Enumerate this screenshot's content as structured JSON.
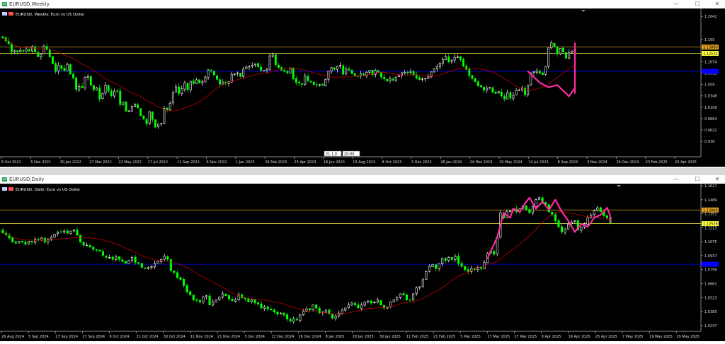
{
  "windows": [
    {
      "title": "EURUSD,Weekly",
      "subtitle": "EURUSD, Weekly: Euro vs US Dollar",
      "chart_data": {
        "type": "candlestick",
        "symbol": "EURUSD",
        "timeframe": "Weekly",
        "ylim": [
          0.905,
          1.215
        ],
        "yticks": [
          1.2042,
          1.155,
          1.1074,
          1.0832,
          1.059,
          1.0348,
          1.0106,
          0.9864,
          0.9622,
          0.938
        ],
        "xticks": [
          "8 Oct 2021",
          "5 Dec 2021",
          "30 Jan 2022",
          "27 Mar 2022",
          "22 May 2022",
          "17 Jul 2022",
          "11 Sep 2022",
          "6 Nov 2022",
          "1 Jan 2023",
          "26 Feb 2023",
          "23 Apr 2023",
          "18 Jun 2023",
          "13 Aug 2023",
          "8 Oct 2023",
          "3 Dec 2023",
          "28 Jan 2024",
          "24 Mar 2024",
          "19 May 2024",
          "14 Jul 2024",
          "8 Sep 2024",
          "3 Nov 2024",
          "29 Dec 2024",
          "23 Feb 2025",
          "20 Apr 2025"
        ],
        "levels": [
          {
            "price": 1.1388,
            "color": "#e0a020",
            "label": "1.13880"
          },
          {
            "price": 1.1255,
            "color": "#ffff40",
            "label": "1.12532"
          },
          {
            "price": 1.0872,
            "color": "#0000ff",
            "label": ""
          }
        ],
        "cursor_label": "21 | 1.0?? | 20:00",
        "close": [
          1.158,
          1.152,
          1.146,
          1.128,
          1.131,
          1.128,
          1.132,
          1.13,
          1.134,
          1.13,
          1.14,
          1.128,
          1.118,
          1.123,
          1.141,
          1.133,
          1.118,
          1.103,
          1.087,
          1.1,
          1.093,
          1.088,
          1.102,
          1.081,
          1.073,
          1.048,
          1.055,
          1.052,
          1.074,
          1.076,
          1.057,
          1.048,
          1.052,
          1.028,
          1.04,
          1.058,
          1.045,
          1.035,
          1.045,
          1.045,
          1.016,
          1.022,
          1.002,
          1.003,
          1.013,
          1.017,
          1.009,
          0.992,
          0.986,
          0.975,
          1.001,
          0.984,
          0.968,
          0.975,
          0.976,
          1.008,
          1.004,
          1.019,
          1.042,
          1.054,
          1.04,
          1.05,
          1.063,
          1.048,
          1.066,
          1.061,
          1.069,
          1.062,
          1.065,
          1.075,
          1.09,
          1.088,
          1.079,
          1.07,
          1.06,
          1.064,
          1.062,
          1.065,
          1.081,
          1.082,
          1.084,
          1.076,
          1.092,
          1.096,
          1.098,
          1.1,
          1.103,
          1.097,
          1.089,
          1.089,
          1.091,
          1.12,
          1.122,
          1.101,
          1.095,
          1.089,
          1.087,
          1.084,
          1.094,
          1.071,
          1.063,
          1.062,
          1.059,
          1.077,
          1.067,
          1.064,
          1.059,
          1.058,
          1.059,
          1.057,
          1.07,
          1.088,
          1.095,
          1.091,
          1.098,
          1.1,
          1.081,
          1.092,
          1.09,
          1.082,
          1.078,
          1.077,
          1.082,
          1.078,
          1.085,
          1.089,
          1.08,
          1.089,
          1.085,
          1.075,
          1.071,
          1.066,
          1.071,
          1.068,
          1.075,
          1.078,
          1.084,
          1.085,
          1.084,
          1.087,
          1.079,
          1.073,
          1.069,
          1.071,
          1.072,
          1.076,
          1.086,
          1.092,
          1.097,
          1.105,
          1.112,
          1.118,
          1.107,
          1.11,
          1.117,
          1.118,
          1.112,
          1.098,
          1.091,
          1.078,
          1.072,
          1.065,
          1.056,
          1.054,
          1.047,
          1.051,
          1.053,
          1.042,
          1.04,
          1.044,
          1.035,
          1.028,
          1.042,
          1.03,
          1.036,
          1.047,
          1.047,
          1.052,
          1.037,
          1.058,
          1.084,
          1.086,
          1.088,
          1.083,
          1.08,
          1.097,
          1.137,
          1.148,
          1.139,
          1.125,
          1.136,
          1.128,
          1.115,
          1.127,
          1.129,
          1.134
        ]
      },
      "cursor_boxes": [
        "21 1.0",
        "20:00"
      ]
    },
    {
      "title": "EURUSD,Daily",
      "subtitle": "EURUSD, Daily: Euro vs US Dollar",
      "chart_data": {
        "type": "candlestick",
        "symbol": "EURUSD",
        "timeframe": "Daily",
        "ylim": [
          1.019,
          1.162
        ],
        "yticks": [
          1.1627,
          1.1489,
          1.1351,
          1.1213,
          1.1075,
          1.0937,
          1.0799,
          1.0661,
          1.0523,
          1.0385,
          1.0247
        ],
        "xticks": [
          "26 Aug 2024",
          "5 Sep 2024",
          "17 Sep 2024",
          "27 Sep 2024",
          "9 Oct 2024",
          "21 Oct 2024",
          "30 Oct 2024",
          "11 Nov 2024",
          "21 Nov 2024",
          "3 Dec 2024",
          "13 Dec 2024",
          "26 Dec 2024",
          "8 Jan 2025",
          "20 Jan 2025",
          "30 Jan 2025",
          "11 Feb 2025",
          "21 Feb 2025",
          "5 Mar 2025",
          "17 Mar 2025",
          "27 Mar 2025",
          "8 Apr 2025",
          "16 Apr 2025",
          "25 Apr 2025",
          "7 May 2025",
          "19 May 2025",
          "29 May 2025"
        ],
        "levels": [
          {
            "price": 1.1388,
            "color": "#e0a020",
            "label": "1.13880"
          },
          {
            "price": 1.1253,
            "color": "#ffff40",
            "label": "1.12526"
          },
          {
            "price": 1.0852,
            "color": "#0000ff",
            "label": ""
          }
        ],
        "close": [
          1.116,
          1.114,
          1.111,
          1.107,
          1.106,
          1.108,
          1.107,
          1.105,
          1.108,
          1.107,
          1.11,
          1.109,
          1.111,
          1.107,
          1.11,
          1.112,
          1.115,
          1.117,
          1.117,
          1.118,
          1.116,
          1.118,
          1.119,
          1.114,
          1.107,
          1.104,
          1.104,
          1.102,
          1.1,
          1.099,
          1.098,
          1.094,
          1.092,
          1.092,
          1.09,
          1.093,
          1.09,
          1.088,
          1.086,
          1.089,
          1.092,
          1.087,
          1.086,
          1.082,
          1.081,
          1.082,
          1.083,
          1.086,
          1.088,
          1.09,
          1.093,
          1.09,
          1.079,
          1.077,
          1.072,
          1.07,
          1.064,
          1.058,
          1.055,
          1.05,
          1.05,
          1.048,
          1.053,
          1.054,
          1.045,
          1.048,
          1.05,
          1.053,
          1.056,
          1.054,
          1.051,
          1.049,
          1.05,
          1.055,
          1.052,
          1.051,
          1.048,
          1.05,
          1.047,
          1.046,
          1.042,
          1.043,
          1.041,
          1.04,
          1.038,
          1.036,
          1.037,
          1.035,
          1.031,
          1.029,
          1.031,
          1.03,
          1.035,
          1.039,
          1.041,
          1.04,
          1.045,
          1.042,
          1.037,
          1.038,
          1.04,
          1.036,
          1.032,
          1.034,
          1.037,
          1.04,
          1.042,
          1.045,
          1.047,
          1.045,
          1.042,
          1.045,
          1.048,
          1.049,
          1.047,
          1.048,
          1.05,
          1.045,
          1.042,
          1.043,
          1.048,
          1.05,
          1.052,
          1.056,
          1.055,
          1.05,
          1.05,
          1.056,
          1.062,
          1.063,
          1.07,
          1.078,
          1.083,
          1.085,
          1.081,
          1.086,
          1.091,
          1.089,
          1.092,
          1.09,
          1.093,
          1.086,
          1.083,
          1.08,
          1.078,
          1.081,
          1.08,
          1.082,
          1.081,
          1.087,
          1.096,
          1.098,
          1.095,
          1.112,
          1.136,
          1.131,
          1.137,
          1.138,
          1.14,
          1.137,
          1.14,
          1.143,
          1.139,
          1.136,
          1.142,
          1.149,
          1.151,
          1.146,
          1.144,
          1.137,
          1.134,
          1.128,
          1.122,
          1.117,
          1.12,
          1.125,
          1.127,
          1.128,
          1.119,
          1.122,
          1.125,
          1.131,
          1.134,
          1.138,
          1.141,
          1.137,
          1.133,
          1.131,
          1.126
        ]
      },
      "cursor_boxes": []
    }
  ],
  "colors": {
    "bull": "#ffffff",
    "bear": "#00ff00",
    "ma": "#c00000",
    "overlay": "#ff2aa0",
    "axis_text": "#dddddd"
  },
  "icons": {
    "window": "mt-chart-icon",
    "minimize": "minimize-icon",
    "restore": "restore-icon",
    "close": "close-icon"
  },
  "controls": {
    "minimize": "—",
    "restore": "☐",
    "close": "✕"
  }
}
